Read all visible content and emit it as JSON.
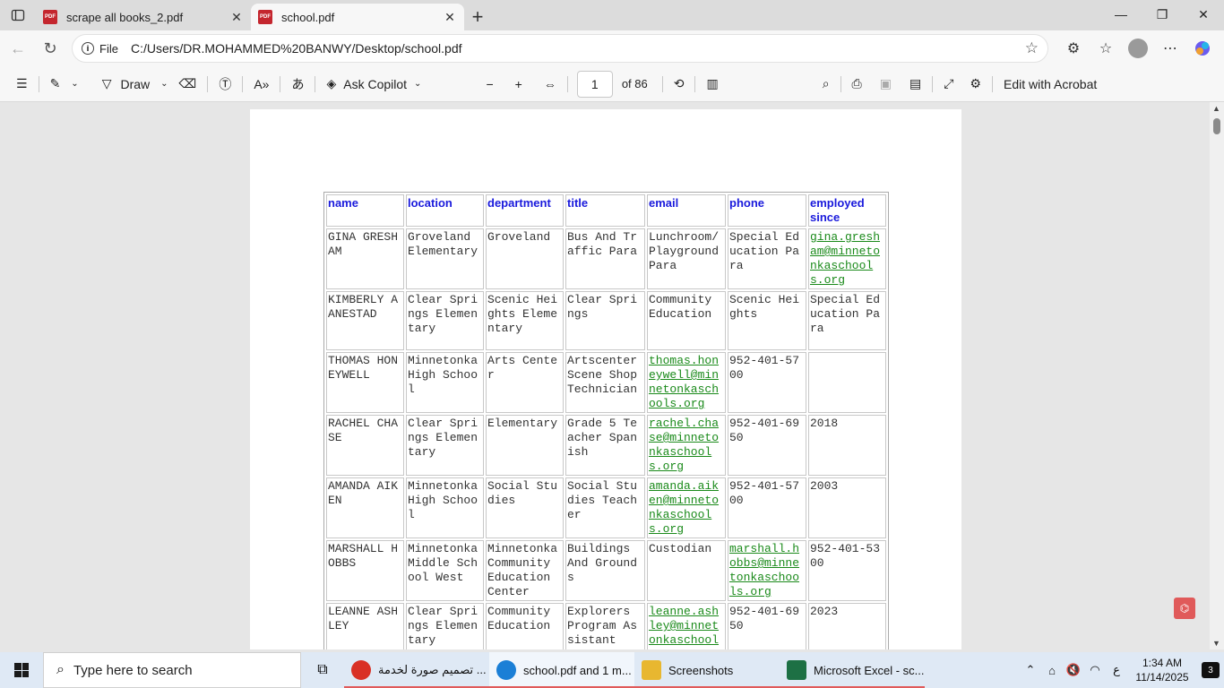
{
  "browser": {
    "tabs": [
      {
        "title": "scrape all books_2.pdf",
        "active": false
      },
      {
        "title": "school.pdf",
        "active": true
      }
    ],
    "address": {
      "scheme_label": "File",
      "url": "C:/Users/DR.MOHAMMED%20BANWY/Desktop/school.pdf"
    }
  },
  "pdf_toolbar": {
    "draw_label": "Draw",
    "copilot_label": "Ask Copilot",
    "current_page": "1",
    "page_total_label": "of 86",
    "edit_label": "Edit with Acrobat"
  },
  "table": {
    "headers": [
      "name",
      "location",
      "department",
      "title",
      "email",
      "phone",
      "employed since"
    ],
    "rows": [
      [
        "GINA GRESHAM",
        "Groveland Elementary",
        "Groveland",
        "Bus And Traffic Para",
        "Lunchroom/ Playground Para",
        "Special Education Para",
        "gina.gresham@minnetonkaschools.org"
      ],
      [
        "KIMBERLY AANESTAD",
        "Clear Springs Elementary",
        "Scenic Heights Elementary",
        "Clear Springs",
        "Community Education",
        "Scenic Heights",
        "Special Education Para"
      ],
      [
        "THOMAS HONEYWELL",
        "Minnetonka High School",
        "Arts Center",
        "Artscenter Scene Shop Technician",
        "thomas.honeywell@minnetonkaschools.org",
        "952-401-5700",
        ""
      ],
      [
        "RACHEL CHASE",
        "Clear Springs Elementary",
        "Elementary",
        "Grade 5 Teacher Spanish",
        "rachel.chase@minnetonkaschools.org",
        "952-401-6950",
        "2018"
      ],
      [
        "AMANDA AIKEN",
        "Minnetonka High School",
        "Social Studies",
        "Social Studies Teacher",
        "amanda.aiken@minnetonkaschools.org",
        "952-401-5700",
        "2003"
      ],
      [
        "MARSHALL HOBBS",
        "Minnetonka Middle School West",
        "Minnetonka Community Education Center",
        "Buildings And Grounds",
        "Custodian",
        "marshall.hobbs@minnetonkaschools.org",
        "952-401-5300"
      ],
      [
        "LEANNE ASHLEY",
        "Clear Springs Elementary",
        "Community Education",
        "Explorers Program Assistant",
        "leanne.ashley@minnetonkaschools.org",
        "952-401-6950",
        "2023"
      ]
    ],
    "link_cells": [
      [
        0,
        6
      ],
      [
        2,
        4
      ],
      [
        3,
        4
      ],
      [
        4,
        4
      ],
      [
        5,
        5
      ],
      [
        6,
        4
      ]
    ]
  },
  "taskbar": {
    "search_placeholder": "Type here to search",
    "apps": [
      {
        "label": "تصميم صورة لخدمة ...",
        "icon_color": "#d93025",
        "icon": "chrome-icon"
      },
      {
        "label": "school.pdf and 1 m...",
        "icon_color": "#1b7fd6",
        "icon": "edge-icon"
      },
      {
        "label": "Screenshots",
        "icon_color": "#e8b730",
        "icon": "folder-icon"
      },
      {
        "label": "Microsoft Excel - sc...",
        "icon_color": "#1d7044",
        "icon": "excel-icon"
      }
    ],
    "time": "1:34 AM",
    "date": "11/14/2025",
    "lang": "ع",
    "notifications": "3"
  }
}
